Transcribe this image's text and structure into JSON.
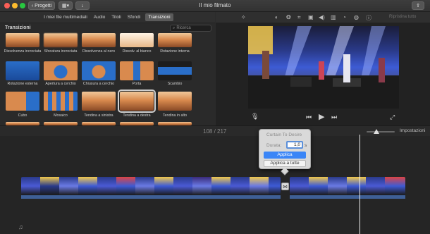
{
  "window": {
    "title": "Il mio filmato"
  },
  "toolbar": {
    "back_label": "Progetti"
  },
  "tabs": [
    {
      "label": "I miei file multimediali"
    },
    {
      "label": "Audio"
    },
    {
      "label": "Titoli"
    },
    {
      "label": "Sfondi"
    },
    {
      "label": "Transizioni"
    }
  ],
  "browser": {
    "title": "Transizioni",
    "search_placeholder": "Ricerca",
    "items": [
      {
        "label": "Dissolvenza incrociata"
      },
      {
        "label": "Sfocatura incrociata"
      },
      {
        "label": "Dissolvenza al nero"
      },
      {
        "label": "Dissolv. al bianco"
      },
      {
        "label": "Rotazione interna"
      },
      {
        "label": "Rotazione esterna"
      },
      {
        "label": "Apertura a cerchio"
      },
      {
        "label": "Chiusura a cerchio"
      },
      {
        "label": "Porta"
      },
      {
        "label": "Scambio"
      },
      {
        "label": "Cubo"
      },
      {
        "label": "Mosaico"
      },
      {
        "label": "Tendina a sinistra"
      },
      {
        "label": "Tendina a destra"
      },
      {
        "label": "Tendina in alto"
      }
    ]
  },
  "viewer": {
    "reset_label": "Ripristina tutto"
  },
  "timeline": {
    "counter": "108 / 217",
    "settings_label": "Impostazioni"
  },
  "popover": {
    "title": "Curtain To Desire",
    "duration_label": "Durata:",
    "duration_value": "1,0",
    "unit": "s",
    "apply_label": "Applica",
    "apply_all_label": "Applica a tutte"
  }
}
